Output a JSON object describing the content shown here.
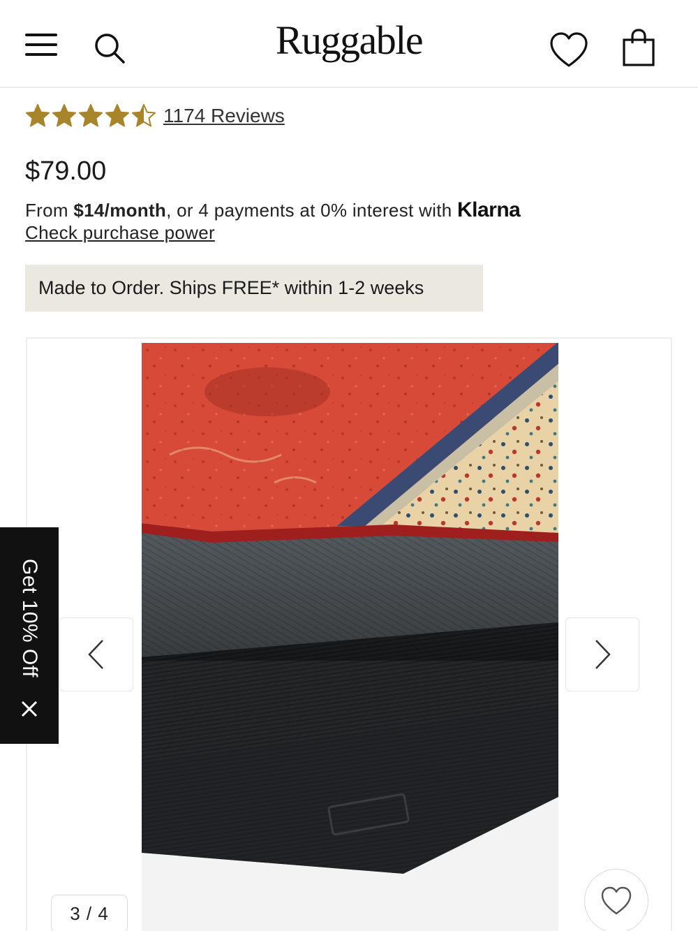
{
  "header": {
    "brand": "Ruggable",
    "menu_icon": "hamburger-menu-icon",
    "search_icon": "search-icon",
    "wishlist_icon": "heart-icon",
    "bag_icon": "shopping-bag-icon"
  },
  "product": {
    "rating": {
      "stars": 4.5,
      "max": 5,
      "reviews_label": "1174 Reviews",
      "star_color": "#a8842a"
    },
    "price": "$79.00",
    "financing": {
      "prefix": "From ",
      "monthly": "$14/month",
      "middle": ", or 4 payments at 0% interest with ",
      "provider": "Klarna",
      "link_label": "Check purchase power"
    },
    "shipping_note": "Made to Order. Ships FREE* within 1-2 weeks"
  },
  "gallery": {
    "counter": "3 / 4",
    "prev_icon": "chevron-left-icon",
    "next_icon": "chevron-right-icon",
    "favorite_icon": "heart-icon"
  },
  "promo": {
    "label": "Get 10% Off",
    "close_icon": "close-icon"
  }
}
